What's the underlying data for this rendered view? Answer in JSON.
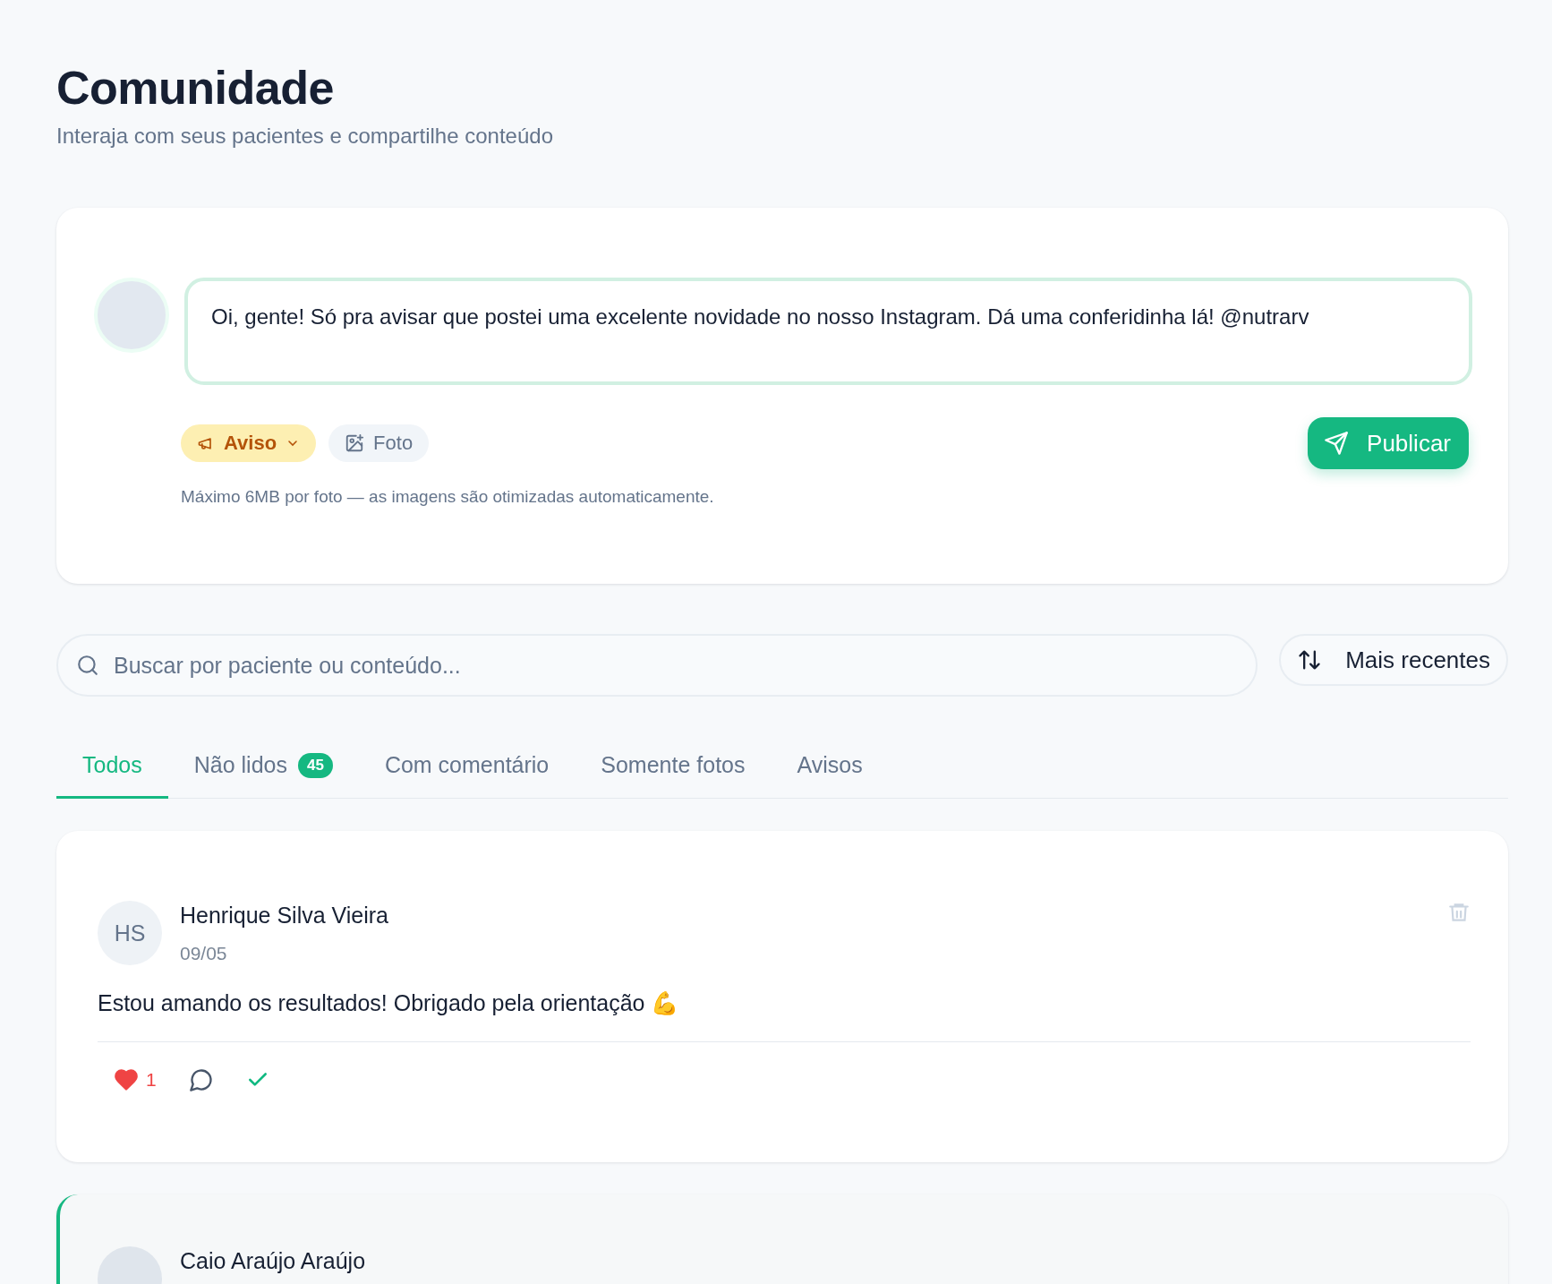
{
  "header": {
    "title": "Comunidade",
    "subtitle": "Interaja com seus pacientes e compartilhe conteúdo"
  },
  "composer": {
    "text": "Oi, gente! Só pra avisar que postei uma excelente novidade no nosso Instagram. Dá uma conferidinha lá! @nutrarv",
    "type_label": "Aviso",
    "photo_label": "Foto",
    "hint": "Máximo 6MB por foto — as imagens são otimizadas automaticamente.",
    "publish_label": "Publicar"
  },
  "search": {
    "placeholder": "Buscar por paciente ou conteúdo..."
  },
  "sort": {
    "label": "Mais recentes"
  },
  "tabs": [
    {
      "label": "Todos",
      "selected": true
    },
    {
      "label": "Não lidos",
      "selected": false,
      "count": "45"
    },
    {
      "label": "Com comentário",
      "selected": false
    },
    {
      "label": "Somente fotos",
      "selected": false
    },
    {
      "label": "Avisos",
      "selected": false
    }
  ],
  "posts": [
    {
      "author": "Henrique Silva Vieira",
      "initials": "HS",
      "date": "09/05",
      "text": "Estou amando os resultados! Obrigado pela orientação 💪",
      "liked": true,
      "likes": "1",
      "unread": false
    },
    {
      "author": "Caio Araújo Araújo",
      "unread": true
    }
  ]
}
